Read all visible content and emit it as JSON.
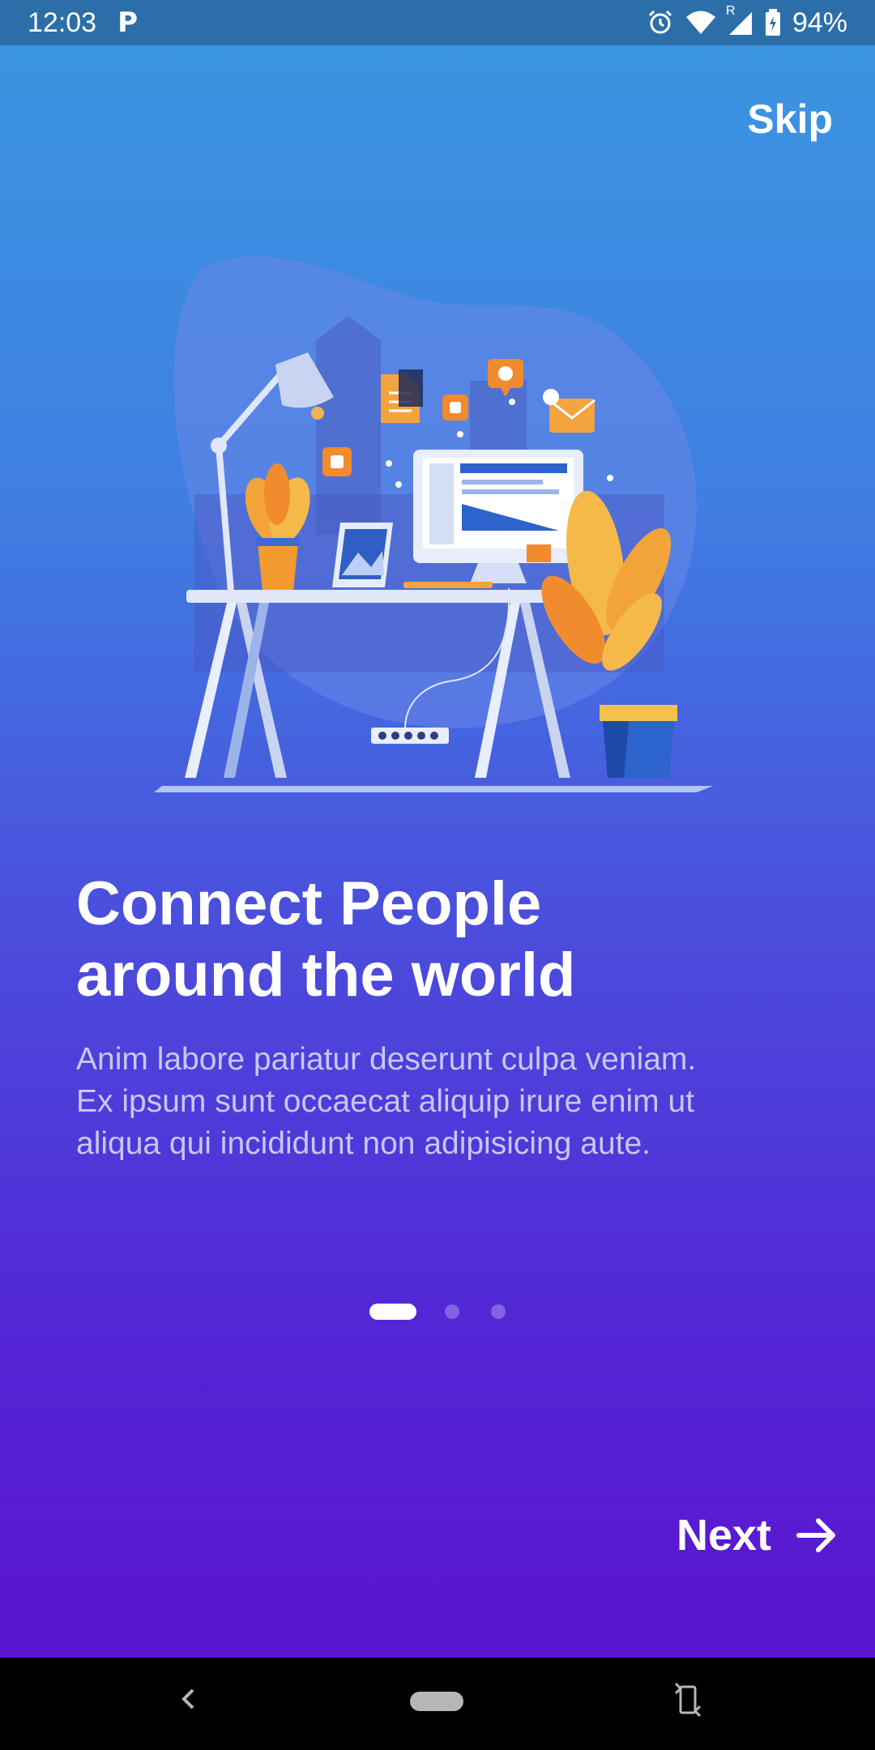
{
  "status_bar": {
    "time": "12:03",
    "app_badge": "P",
    "battery": "94%",
    "roaming": "R"
  },
  "onboarding": {
    "skip_label": "Skip",
    "title_line1": "Connect People",
    "title_line2": "around the world",
    "body_line1": "Anim labore pariatur deserunt culpa veniam.",
    "body_line2": "Ex ipsum sunt occaecat aliquip irure enim ut",
    "body_line3": "aliqua qui incididunt non adipisicing aute.",
    "page_indicator": {
      "current": 1,
      "total": 3
    },
    "next_label": "Next"
  },
  "icons": {
    "alarm": "alarm-icon",
    "wifi": "wifi-icon",
    "signal": "signal-icon",
    "battery": "battery-icon",
    "next": "arrow-right-icon",
    "back": "back-icon",
    "home": "home-pill",
    "rotate": "rotate-icon"
  },
  "colors": {
    "gradient_top": "#3a97e0",
    "gradient_bottom": "#5b14cf",
    "status_bar": "#2c6fa8",
    "accent_orange": "#f28a2e",
    "body_text": "#c4c8f3"
  }
}
